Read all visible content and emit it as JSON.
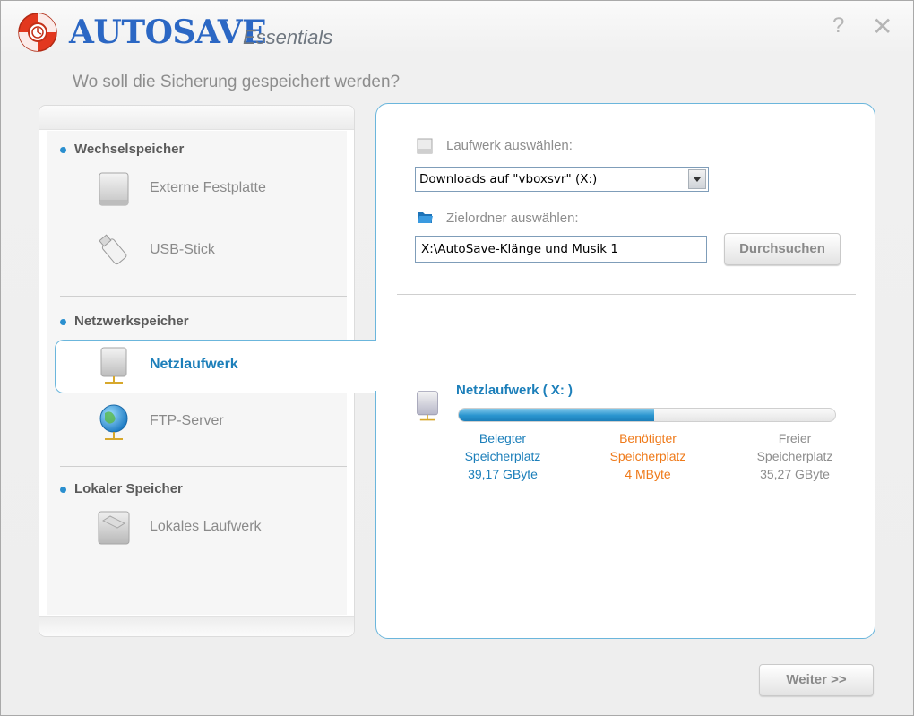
{
  "header": {
    "brand": "AUTOSAVE",
    "brand_sub": "Essentials",
    "help": "?",
    "close": "✕"
  },
  "question": "Wo soll die Sicherung gespeichert werden?",
  "sidebar": {
    "groups": [
      {
        "label": "Wechselspeicher",
        "items": [
          {
            "label": "Externe Festplatte"
          },
          {
            "label": "USB-Stick"
          }
        ]
      },
      {
        "label": "Netzwerkspeicher",
        "items": [
          {
            "label": "Netzlaufwerk",
            "selected": true
          },
          {
            "label": "FTP-Server"
          }
        ]
      },
      {
        "label": "Lokaler Speicher",
        "items": [
          {
            "label": "Lokales Laufwerk"
          }
        ]
      }
    ]
  },
  "main": {
    "drive_label": "Laufwerk auswählen:",
    "drive_value": "Downloads auf \"vboxsvr\" (X:)",
    "folder_label": "Zielordner auswählen:",
    "folder_value": "X:\\AutoSave-Klänge und Musik 1",
    "browse_button": "Durchsuchen",
    "drive_title": "Netzlaufwerk ( X: )",
    "usage": {
      "used_fraction": 0.52,
      "used_line1": "Belegter",
      "used_line2": "Speicherplatz",
      "used_value": "39,17 GByte",
      "needed_line1": "Benötigter",
      "needed_line2": "Speicherplatz",
      "needed_value": "4 MByte",
      "free_line1": "Freier",
      "free_line2": "Speicherplatz",
      "free_value": "35,27 GByte"
    }
  },
  "footer": {
    "next_button": "Weiter >>"
  },
  "colors": {
    "accent": "#1c7fba",
    "needed": "#ef7a1a",
    "muted": "#8d8d8d"
  }
}
